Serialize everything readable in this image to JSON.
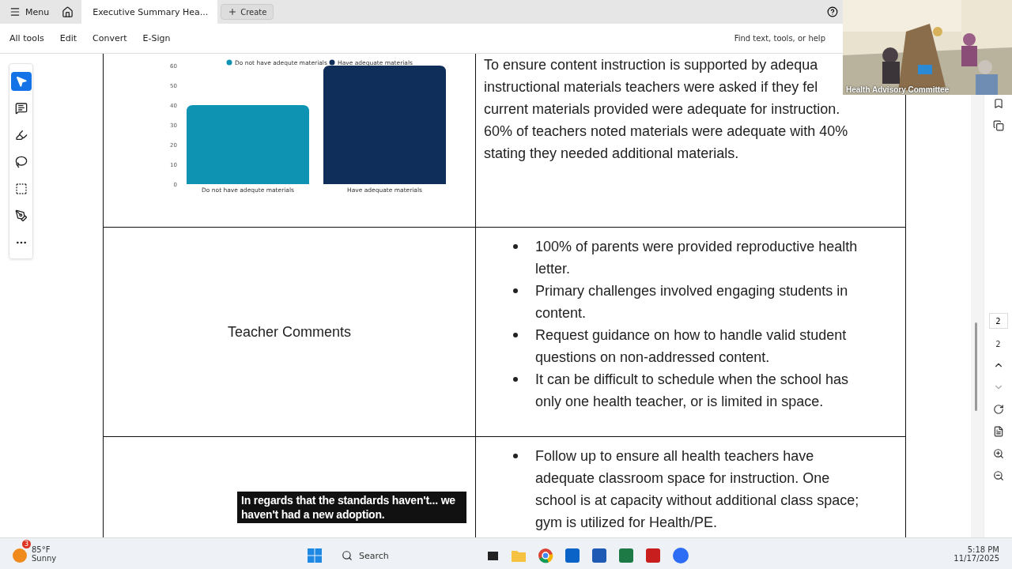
{
  "app_tabs": {
    "menu": "Menu",
    "document_tab": {
      "title": "Executive Summary Hea...",
      "selected": true
    },
    "create": "Create"
  },
  "toolbar": {
    "items": [
      "All tools",
      "Edit",
      "Convert",
      "E-Sign"
    ],
    "search_hint": "Find text, tools, or help"
  },
  "tool_rail": [
    {
      "kind": "select",
      "selected": true
    },
    {
      "kind": "comment",
      "selected": false
    },
    {
      "kind": "highlight",
      "selected": false
    },
    {
      "kind": "draw",
      "selected": false
    },
    {
      "kind": "text",
      "selected": false
    },
    {
      "kind": "sign",
      "selected": false
    },
    {
      "kind": "more",
      "selected": false
    }
  ],
  "document": {
    "rows": [
      {
        "left": {
          "kind": "chart",
          "chart_data": {
            "type": "bar",
            "categories": [
              "Do not have adequte materials",
              "Have adequate materials"
            ],
            "series": [
              {
                "name": "Do not have adequte materials",
                "color": "#0e93b3",
                "values": [
                  40,
                  null
                ]
              },
              {
                "name": "Have adequate materials",
                "color": "#0f2f5a",
                "values": [
                  null,
                  60
                ]
              }
            ],
            "ylim": [
              0,
              60
            ],
            "yticks": [
              0,
              10,
              20,
              30,
              40,
              50,
              60
            ]
          }
        },
        "right": {
          "kind": "lines",
          "lines": [
            "To ensure content instruction is supported by adequa",
            "instructional materials teachers were asked if they fel",
            "current materials provided were adequate for instruction.",
            "60% of teachers noted materials were adequate with 40%",
            "stating they needed additional materials."
          ]
        }
      },
      {
        "left": {
          "kind": "label",
          "text": "Teacher Comments"
        },
        "right": {
          "kind": "bullets",
          "bullets": [
            "100% of parents were provided reproductive health letter.",
            "Primary challenges involved engaging students in content.",
            "Request guidance on how to handle valid student questions on non-addressed content.",
            "It can be difficult to schedule when the school has only one health teacher, or is limited in space."
          ]
        }
      },
      {
        "left": {
          "kind": "empty"
        },
        "right": {
          "kind": "bullets",
          "bullets": [
            "Follow up to ensure all health teachers have adequate classroom space for instruction. One school is at capacity without additional class space; gym is utilized for Health/PE."
          ]
        }
      }
    ]
  },
  "page_nav": {
    "current": "2",
    "total": "2"
  },
  "video": {
    "caption": "Health Advisory Committee"
  },
  "subtitle": "In regards that the standards haven't... we haven't had a new adoption.",
  "taskbar": {
    "weather": {
      "badge": "3",
      "temp": "85°F",
      "condition": "Sunny"
    },
    "search": "Search",
    "apps": [
      {
        "kind": "taskview"
      },
      {
        "kind": "folder"
      },
      {
        "kind": "chrome"
      },
      {
        "kind": "outlook"
      },
      {
        "kind": "word"
      },
      {
        "kind": "excel"
      },
      {
        "kind": "acrobat"
      },
      {
        "kind": "zoom"
      }
    ],
    "time": "5:18 PM",
    "date": "11/17/2025"
  }
}
